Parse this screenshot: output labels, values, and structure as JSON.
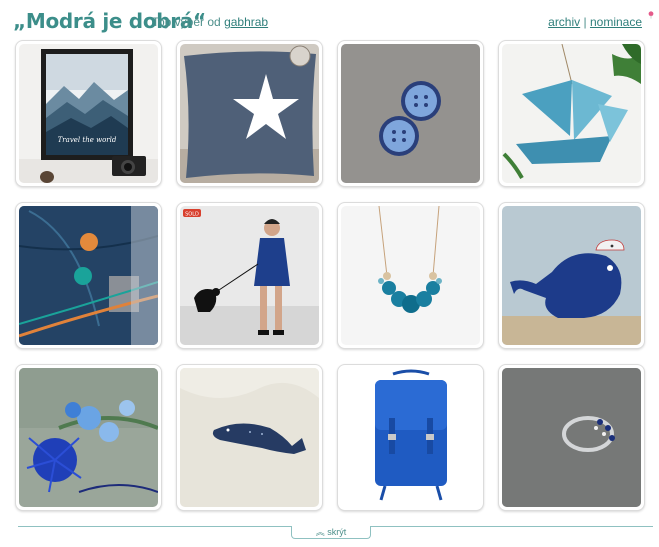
{
  "header": {
    "title": "„Modrá je dobrá“",
    "subtitle_prefix": "Top výběr od",
    "subtitle_user": "gabhrab",
    "archive_label": "archiv",
    "separator": "|",
    "nominate_label": "nominace"
  },
  "colors": {
    "accent": "#3c8e8a",
    "link": "#2f7f7b",
    "pin": "#e55a8a"
  },
  "tiles": [
    {
      "name": "mountain-poster",
      "label": "Travel the world"
    },
    {
      "name": "star-pillow",
      "label": ""
    },
    {
      "name": "blue-buttons",
      "label": ""
    },
    {
      "name": "ceramic-boats",
      "label": ""
    },
    {
      "name": "denim-fabric",
      "label": ""
    },
    {
      "name": "woman-blue-dress",
      "label": "SOLD"
    },
    {
      "name": "felt-bead-necklace",
      "label": ""
    },
    {
      "name": "ceramic-whale",
      "label": ""
    },
    {
      "name": "blue-flowers",
      "label": ""
    },
    {
      "name": "whale-brooch",
      "label": ""
    },
    {
      "name": "blue-backpack",
      "label": ""
    },
    {
      "name": "silver-ring",
      "label": ""
    }
  ],
  "footer": {
    "hide_label": "skrýt",
    "hide_icon": "double-chevron-up-icon"
  }
}
